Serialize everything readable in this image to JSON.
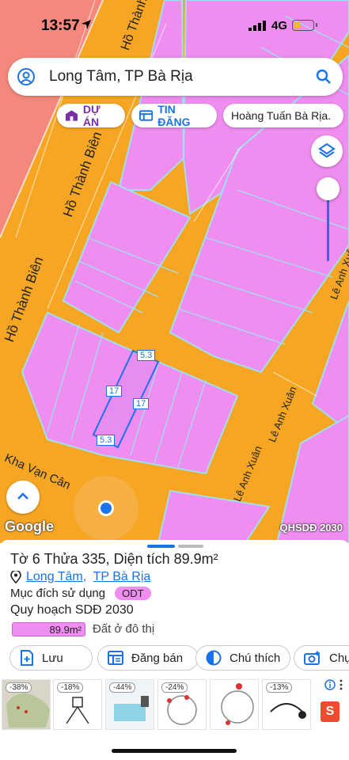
{
  "status_bar": {
    "time": "13:57",
    "network": "4G"
  },
  "search": {
    "query": "Long Tâm, TP Bà Rịa",
    "icon_left": "user-circle-icon",
    "icon_right": "search-icon"
  },
  "chips": [
    {
      "label": "DỰ ÁN",
      "icon": "building-icon",
      "color": "#7b2fa6"
    },
    {
      "label": "TIN ĐĂNG",
      "icon": "listing-icon",
      "color": "#1a73e8"
    },
    {
      "label": "Hoàng Tuấn Bà Rịa."
    }
  ],
  "map": {
    "street_labels": [
      "Hồ Thành Biên",
      "Hồ Thành Biên",
      "Hồ Thành Biên",
      "Lê Anh Xuân",
      "Lê Anh Xuân",
      "Lê Anh Xuân",
      "Kha Vạn Cân"
    ],
    "parcel_dimensions": [
      "5.3",
      "17",
      "17",
      "5.3"
    ],
    "attribution_left": "Google",
    "attribution_right": "QHSDĐ 2030",
    "colors": {
      "road": "#f6a623",
      "residential_land": "#f08df0",
      "outside_area": "#f4887c",
      "parcel_outline": "#1a73e8"
    }
  },
  "sheet": {
    "title": "Tờ 6 Thửa 335, Diện tích 89.9m²",
    "location_ward": "Long Tâm",
    "location_city": "TP Bà Rịa",
    "purpose_label": "Mục đích sử dụng",
    "purpose_code": "ODT",
    "plan_label": "Quy hoạch SDĐ 2030",
    "area_value": "89.9m²",
    "area_type": "Đất ở đô thị",
    "actions": [
      {
        "label": "Lưu",
        "icon": "save-plus-icon"
      },
      {
        "label": "Đăng bán",
        "icon": "post-listing-icon"
      },
      {
        "label": "Chú thích",
        "icon": "legend-icon"
      },
      {
        "label": "Chụp",
        "icon": "camera-icon"
      }
    ]
  },
  "ads": [
    {
      "discount": "-38%"
    },
    {
      "discount": "-18%"
    },
    {
      "discount": "-44%"
    },
    {
      "discount": "-24%"
    },
    {
      "discount": ""
    },
    {
      "discount": "-13%"
    }
  ]
}
